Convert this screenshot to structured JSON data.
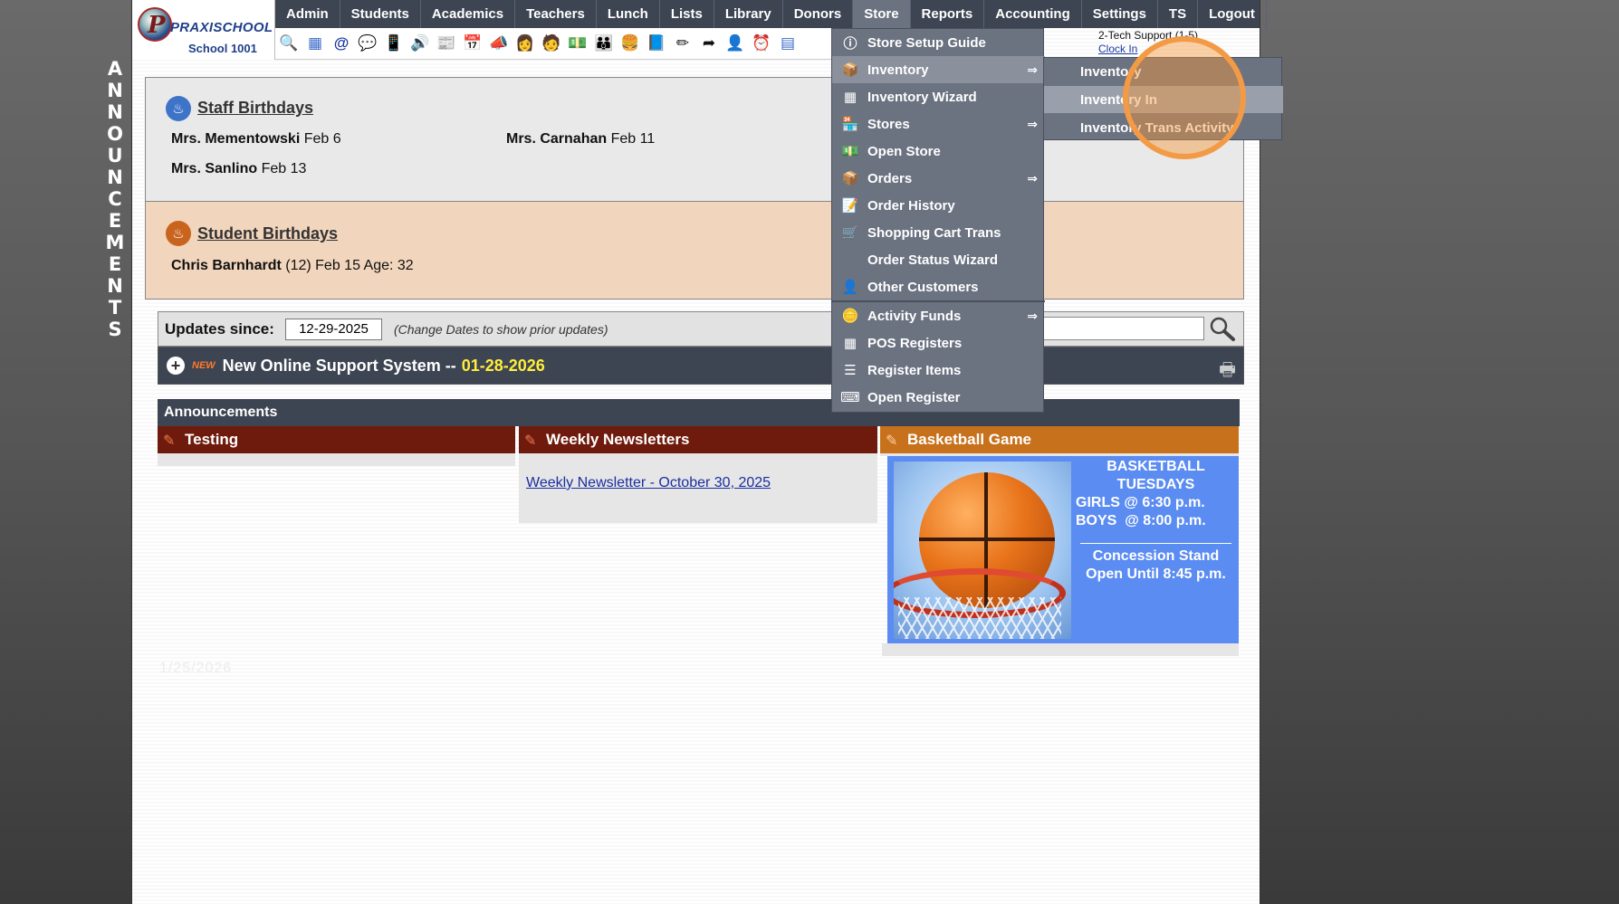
{
  "vertical_label": [
    "A",
    "N",
    "N",
    "O",
    "U",
    "N",
    "C",
    "E",
    "M",
    "E",
    "N",
    "T",
    "S"
  ],
  "logo": {
    "letter": "P",
    "name": "PRAXISCHOOL",
    "school": "School 1001"
  },
  "nav": [
    "Admin",
    "Students",
    "Academics",
    "Teachers",
    "Lunch",
    "Lists",
    "Library",
    "Donors",
    "Store",
    "Reports",
    "Accounting",
    "Settings",
    "TS",
    "Logout"
  ],
  "nav_active": "Store",
  "toolbar_icons": [
    "search-icon",
    "calendar-grid-icon",
    "email-icon",
    "chat-icon",
    "phone-icon",
    "speaker-icon",
    "newsletter-icon",
    "calendar-icon",
    "megaphone-icon",
    "teacher-icon",
    "student-icon",
    "money-icon",
    "parents-icon",
    "burger-icon",
    "book-icon",
    "pencil-icon",
    "export-icon",
    "admin-icon",
    "clock-icon",
    "table-icon"
  ],
  "top_right": {
    "support": "2-Tech Support (1-5)",
    "clock": "Clock In"
  },
  "staff_birthdays": {
    "title": "Staff Birthdays",
    "entries": [
      {
        "name": "Mrs. Mementowski",
        "date": "Feb 6"
      },
      {
        "name": "Mrs. Carnahan",
        "date": "Feb 11"
      },
      {
        "name": "Mrs. Sanlino",
        "date": "Feb 13"
      }
    ]
  },
  "student_birthdays": {
    "title": "Student Birthdays",
    "entries": [
      {
        "name": "Chris Barnhardt",
        "detail": "(12) Feb 15 Age: 32"
      }
    ]
  },
  "updates": {
    "label": "Updates since:",
    "date": "12-29-2025",
    "hint": "(Change Dates to show prior updates)"
  },
  "news": {
    "badge": "NEW",
    "title": "New Online Support System --",
    "date": "01-28-2026"
  },
  "announcements": {
    "header": "Announcements",
    "columns": [
      {
        "title": "Testing",
        "color": "#6e1a0c"
      },
      {
        "title": "Weekly Newsletters",
        "color": "#6e1a0c",
        "link": "Weekly Newsletter - October 30, 2025"
      },
      {
        "title": "Basketball Game",
        "color": "#c8711c"
      }
    ],
    "basketball": {
      "line1": "BASKETBALL",
      "line2": "TUESDAYS",
      "line3": "GIRLS @ 6:30 p.m.",
      "line4": "BOYS  @ 8:00 p.m.",
      "line5": "Concession Stand",
      "line6": "Open Until 8:45 p.m."
    }
  },
  "faint_text": "1/25/2026",
  "store_menu": [
    {
      "label": "Store Setup Guide",
      "icon": "guide-icon"
    },
    {
      "label": "Inventory",
      "icon": "inventory-icon",
      "submenu": true,
      "highlight": true
    },
    {
      "label": "Inventory Wizard",
      "icon": "wizard-icon"
    },
    {
      "label": "Stores",
      "icon": "store-icon",
      "submenu": true
    },
    {
      "label": "Open Store",
      "icon": "cash-register-icon"
    },
    {
      "label": "Orders",
      "icon": "box-icon",
      "submenu": true
    },
    {
      "label": "Order History",
      "icon": "history-icon"
    },
    {
      "label": "Shopping Cart Trans",
      "icon": "cart-icon"
    },
    {
      "label": "Order Status Wizard",
      "icon": ""
    },
    {
      "label": "Other Customers",
      "icon": "customer-icon"
    },
    {
      "label": "Activity Funds",
      "icon": "coins-icon",
      "submenu": true
    },
    {
      "label": "POS Registers",
      "icon": "pos-icon"
    },
    {
      "label": "Register Items",
      "icon": "list-icon"
    },
    {
      "label": "Open Register",
      "icon": "register-icon"
    }
  ],
  "submenu_arrow": "⇒",
  "inventory_submenu": [
    "Inventory",
    "Inventory In",
    "Inventory Trans Activity"
  ]
}
